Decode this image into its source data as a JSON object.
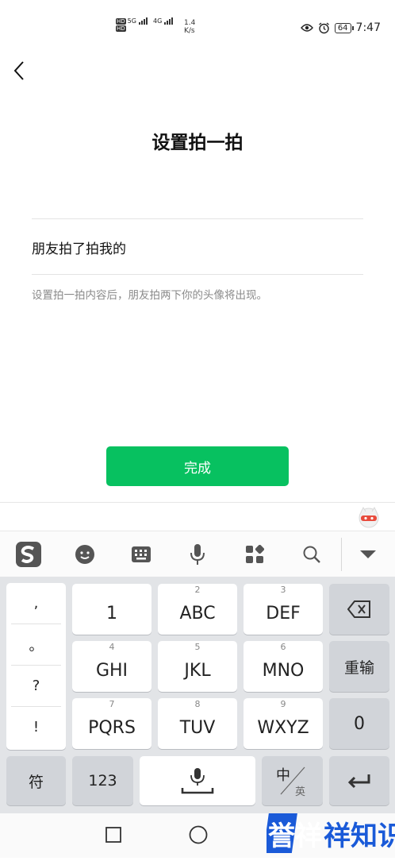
{
  "status_bar": {
    "speed_value": "1.4",
    "speed_unit": "K/s",
    "net_1": "5G",
    "net_2": "4G",
    "battery": "64",
    "time": "7:47"
  },
  "header": {
    "title": "设置拍一拍"
  },
  "form": {
    "input_value": "朋友拍了拍我的",
    "hint": "设置拍一拍内容后，朋友拍两下你的头像将出现。",
    "done_label": "完成"
  },
  "keyboard": {
    "punctuation": [
      ",",
      "。",
      "?",
      "!"
    ],
    "keys": [
      {
        "num": "",
        "label": "1"
      },
      {
        "num": "2",
        "label": "ABC"
      },
      {
        "num": "3",
        "label": "DEF"
      },
      {
        "num": "4",
        "label": "GHI"
      },
      {
        "num": "5",
        "label": "JKL"
      },
      {
        "num": "6",
        "label": "MNO"
      },
      {
        "num": "7",
        "label": "PQRS"
      },
      {
        "num": "8",
        "label": "TUV"
      },
      {
        "num": "9",
        "label": "WXYZ"
      }
    ],
    "reenter": "重输",
    "zero": "0",
    "symbol": "符",
    "num_switch": "123",
    "lang_zh": "中",
    "lang_en": "英"
  },
  "watermark": {
    "text": "誉祥祥知识"
  },
  "colors": {
    "accent": "#07c160",
    "keyboard_bg": "#e2e4e7",
    "key_gray": "#d1d4d9"
  },
  "icons": [
    "back-icon",
    "eye-icon",
    "alarm-icon",
    "sogou-logo-icon",
    "emoji-icon",
    "keyboard-icon",
    "mic-icon",
    "grid-icon",
    "search-icon",
    "collapse-icon",
    "backspace-icon",
    "enter-icon",
    "space-mic-icon",
    "square-nav-icon",
    "circle-nav-icon"
  ]
}
